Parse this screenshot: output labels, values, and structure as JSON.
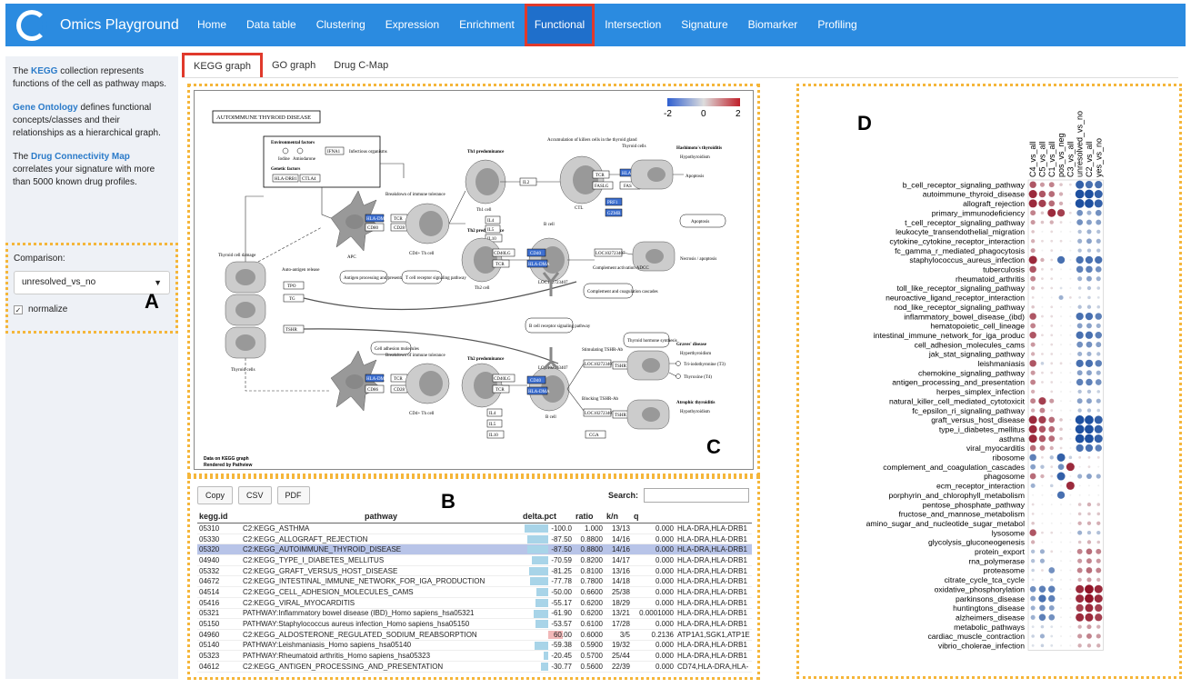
{
  "app": {
    "title": "Omics Playground"
  },
  "nav": {
    "items": [
      "Home",
      "Data table",
      "Clustering",
      "Expression",
      "Enrichment",
      "Functional",
      "Intersection",
      "Signature",
      "Biomarker",
      "Profiling"
    ],
    "active": "Functional"
  },
  "sidebar": {
    "p1_pre": "The ",
    "p1_link": "KEGG",
    "p1_post": " collection represents functions of the cell as pathway maps.",
    "p2_link": "Gene Ontology",
    "p2_post": " defines functional concepts/classes and their relationships as a hierarchical graph.",
    "p3_pre": "The ",
    "p3_link": "Drug Connectivity Map",
    "p3_post": " correlates your signature with more than 5000 known drug profiles.",
    "comparison_label": "Comparison:",
    "comparison_value": "unresolved_vs_no",
    "normalize_label": "normalize"
  },
  "panel_letters": {
    "a": "A",
    "b": "B",
    "c": "C",
    "d": "D"
  },
  "tabs": [
    "KEGG graph",
    "GO graph",
    "Drug C-Map"
  ],
  "kegg": {
    "title": "AUTOIMMUNE THYROID DISEASE",
    "legend_ticks": [
      "-2",
      "0",
      "2"
    ],
    "footer1": "Data on KEGG graph",
    "footer2": "Rendered by Pathview",
    "labels": {
      "env": "Environmental factors",
      "iodine": "Iodine",
      "amiodarone": "Amiodarone",
      "ifna1": "IFNA1",
      "infect": "Infectious organisms",
      "genetic": "Genetic factors",
      "hladrb": "HLA-DRB1",
      "ctla4": "CTLA4",
      "th1pre": "Th1 predominance",
      "accum": "Accumulation of killers cells in the thyroid gland",
      "thyroid_cells": "Thyroid cells",
      "hashimoto": "Hashimoto's thyroiditis",
      "hypo": "Hypothyroidism",
      "apoptosis": "Apoptosis",
      "breakdown": "Breakdown of immune tolerance",
      "antigen": "Antigen",
      "hladma": "HLA-DMA",
      "tcr": "TCR",
      "cd80": "CD80",
      "cd28": "CD28",
      "apc": "APC",
      "cd4": "CD4+ Th cell",
      "th1cell": "Th1 cell",
      "il2": "IL2",
      "hlae": "HLA-E",
      "faslg": "FASLG",
      "fas": "FAS",
      "prf1": "PRF1",
      "gzmb": "GZMB",
      "ctl": "CTL",
      "apoptosis2": "Apoptosis",
      "thyroid_damage": "Thyroid cell damage",
      "autoag": "Auto-antigen release",
      "tpo": "TPO",
      "tg": "TG",
      "tshr": "TSHR",
      "aproc": "Antigen processing and presentation",
      "tcrsig": "T cell receptor signaling pathway",
      "il4": "IL4",
      "il5": "IL5",
      "il10": "IL10",
      "cd40lg": "CD40LG",
      "cd40": "CD40",
      "bcell": "B cell",
      "th2cell": "Th2 cell",
      "loc": "LOC102723407",
      "necrosis": "Necrosis / apoptosis",
      "comp": "Complement activation ADCC",
      "compcasc": "Complement and coagulation cascades",
      "bcr": "B cell receptor signaling pathway",
      "celladh": "Cell adhesion molecules",
      "th2pre": "Th2 predominance",
      "thyroid_horm": "Thyroid hormone synthesis",
      "graves": "Graves' disease",
      "hyper": "Hyperthyroidism",
      "stim": "Stimulating TSHR-Ab",
      "block": "Blocking TSHR-Ab",
      "t3": "Tri-iodothyronine (T3)",
      "t4": "Thyroxine (T4)",
      "atrophic": "Atrophic thyroiditis",
      "hypo2": "Hypothyroidism",
      "cga": "CGA",
      "cd86": "CD86",
      "thyroid_cells2": "Thyroid cells"
    }
  },
  "table": {
    "buttons": [
      "Copy",
      "CSV",
      "PDF"
    ],
    "search_label": "Search:",
    "columns": [
      "kegg.id",
      "pathway",
      "delta.pct",
      "ratio",
      "k/n",
      "q",
      ""
    ],
    "rows": [
      [
        "05310",
        "C2:KEGG_ASTHMA",
        "-100.0",
        "1.000",
        "13/13",
        "0.000",
        "HLA-DRA,HLA-DRB1"
      ],
      [
        "05330",
        "C2:KEGG_ALLOGRAFT_REJECTION",
        "-87.50",
        "0.8800",
        "14/16",
        "0.000",
        "HLA-DRA,HLA-DRB1"
      ],
      [
        "05320",
        "C2:KEGG_AUTOIMMUNE_THYROID_DISEASE",
        "-87.50",
        "0.8800",
        "14/16",
        "0.000",
        "HLA-DRA,HLA-DRB1"
      ],
      [
        "04940",
        "C2:KEGG_TYPE_I_DIABETES_MELLITUS",
        "-70.59",
        "0.8200",
        "14/17",
        "0.000",
        "HLA-DRA,HLA-DRB1"
      ],
      [
        "05332",
        "C2:KEGG_GRAFT_VERSUS_HOST_DISEASE",
        "-81.25",
        "0.8100",
        "13/16",
        "0.000",
        "HLA-DRA,HLA-DRB1"
      ],
      [
        "04672",
        "C2:KEGG_INTESTINAL_IMMUNE_NETWORK_FOR_IGA_PRODUCTION",
        "-77.78",
        "0.7800",
        "14/18",
        "0.000",
        "HLA-DRA,HLA-DRB1"
      ],
      [
        "04514",
        "C2:KEGG_CELL_ADHESION_MOLECULES_CAMS",
        "-50.00",
        "0.6600",
        "25/38",
        "0.000",
        "HLA-DRA,HLA-DRB1"
      ],
      [
        "05416",
        "C2:KEGG_VIRAL_MYOCARDITIS",
        "-55.17",
        "0.6200",
        "18/29",
        "0.000",
        "HLA-DRA,HLA-DRB1"
      ],
      [
        "05321",
        "PATHWAY:Inflammatory bowel disease (IBD)_Homo sapiens_hsa05321",
        "-61.90",
        "0.6200",
        "13/21",
        "0.0001000",
        "HLA-DRA,HLA-DRB1"
      ],
      [
        "05150",
        "PATHWAY:Staphylococcus aureus infection_Homo sapiens_hsa05150",
        "-53.57",
        "0.6100",
        "17/28",
        "0.000",
        "HLA-DRA,HLA-DRB1"
      ],
      [
        "04960",
        "C2:KEGG_ALDOSTERONE_REGULATED_SODIUM_REABSORPTION",
        "60.00",
        "0.6000",
        "3/5",
        "0.2136",
        "ATP1A1,SGK1,ATP1E"
      ],
      [
        "05140",
        "PATHWAY:Leishmaniasis_Homo sapiens_hsa05140",
        "-59.38",
        "0.5900",
        "19/32",
        "0.000",
        "HLA-DRA,HLA-DRB1"
      ],
      [
        "05323",
        "PATHWAY:Rheumatoid arthritis_Homo sapiens_hsa05323",
        "-20.45",
        "0.5700",
        "25/44",
        "0.000",
        "HLA-DRA,HLA-DRB1"
      ],
      [
        "04612",
        "C2:KEGG_ANTIGEN_PROCESSING_AND_PRESENTATION",
        "-30.77",
        "0.5600",
        "22/39",
        "0.000",
        "CD74,HLA-DRA,HLA-"
      ]
    ],
    "delta_values": [
      -100.0,
      -87.5,
      -87.5,
      -70.59,
      -81.25,
      -77.78,
      -50.0,
      -55.17,
      -61.9,
      -53.57,
      60.0,
      -59.38,
      -20.45,
      -30.77
    ],
    "selected_row": 2
  },
  "heatmap": {
    "columns": [
      "C4_vs_all",
      "C5_vs_all",
      "C1_vs_all",
      "pos_vs_neg",
      "C3_vs_all",
      "unresolved_vs_no",
      "C2_vs_all",
      "yes_vs_no"
    ],
    "rows": [
      "b_cell_receptor_signaling_pathway",
      "autoimmune_thyroid_disease",
      "allograft_rejection",
      "primary_immunodeficiency",
      "t_cell_receptor_signaling_pathway",
      "leukocyte_transendothelial_migration",
      "cytokine_cytokine_receptor_interaction",
      "fc_gamma_r_mediated_phagocytosis",
      "staphylococcus_aureus_infection",
      "tuberculosis",
      "rheumatoid_arthritis",
      "toll_like_receptor_signaling_pathway",
      "neuroactive_ligand_receptor_interaction",
      "nod_like_receptor_signaling_pathway",
      "inflammatory_bowel_disease_(ibd)",
      "hematopoietic_cell_lineage",
      "intestinal_immune_network_for_iga_produc",
      "cell_adhesion_molecules_cams",
      "jak_stat_signaling_pathway",
      "leishmaniasis",
      "chemokine_signaling_pathway",
      "antigen_processing_and_presentation",
      "herpes_simplex_infection",
      "natural_killer_cell_mediated_cytotoxicit",
      "fc_epsilon_ri_signaling_pathway",
      "graft_versus_host_disease",
      "type_i_diabetes_mellitus",
      "asthma",
      "viral_myocarditis",
      "ribosome",
      "complement_and_coagulation_cascades",
      "phagosome",
      "ecm_receptor_interaction",
      "porphyrin_and_chlorophyll_metabolism",
      "pentose_phosphate_pathway",
      "fructose_and_mannose_metabolism",
      "amino_sugar_and_nucleotide_sugar_metabol",
      "lysosome",
      "glycolysis_gluconeogenesis",
      "protein_export",
      "rna_polymerase",
      "proteasome",
      "citrate_cycle_tca_cycle",
      "oxidative_phosphorylation",
      "parkinsons_disease",
      "huntingtons_disease",
      "alzheimers_disease",
      "metabolic_pathways",
      "cardiac_muscle_contraction",
      "vibrio_cholerae_infection"
    ],
    "values": [
      [
        0.7,
        0.4,
        0.5,
        0.2,
        0.1,
        -0.9,
        -0.8,
        -0.8
      ],
      [
        0.9,
        0.7,
        0.6,
        0.3,
        0,
        -1,
        -1,
        -0.9
      ],
      [
        0.9,
        0.8,
        0.6,
        0.3,
        0,
        -1,
        -1,
        -0.9
      ],
      [
        0.5,
        0.2,
        0.9,
        0.8,
        0.1,
        -0.6,
        -0.4,
        -0.6
      ],
      [
        0.4,
        0.2,
        0.3,
        0.1,
        0,
        -0.6,
        -0.5,
        -0.5
      ],
      [
        0.2,
        0,
        0.1,
        0,
        0,
        -0.3,
        -0.4,
        -0.3
      ],
      [
        0.3,
        0.1,
        0.1,
        0.1,
        0,
        -0.4,
        -0.5,
        -0.4
      ],
      [
        0.4,
        0,
        0.1,
        0,
        0,
        -0.3,
        -0.3,
        -0.3
      ],
      [
        0.9,
        0.3,
        0.1,
        -0.8,
        0,
        -0.8,
        -0.8,
        -0.8
      ],
      [
        0.7,
        0.1,
        0.1,
        0,
        0,
        -0.7,
        -0.7,
        -0.6
      ],
      [
        0.5,
        0.1,
        0.1,
        0,
        0,
        -0.4,
        -0.5,
        -0.4
      ],
      [
        0.3,
        0.1,
        0.1,
        -0.1,
        0,
        -0.2,
        -0.3,
        -0.2
      ],
      [
        0.1,
        0,
        0,
        -0.4,
        0.1,
        -0.1,
        -0.2,
        -0.1
      ],
      [
        0.2,
        0,
        0.1,
        0,
        0,
        -0.3,
        -0.3,
        -0.2
      ],
      [
        0.7,
        0.1,
        0.1,
        0,
        0,
        -0.8,
        -0.8,
        -0.7
      ],
      [
        0.5,
        0,
        0.1,
        0,
        0,
        -0.5,
        -0.5,
        -0.4
      ],
      [
        0.7,
        0.1,
        0.1,
        0,
        0,
        -0.8,
        -0.8,
        -0.7
      ],
      [
        0.4,
        0,
        0.1,
        0,
        0,
        -0.6,
        -0.6,
        -0.5
      ],
      [
        0.3,
        0.1,
        0.1,
        0,
        0,
        -0.4,
        -0.4,
        -0.3
      ],
      [
        0.7,
        -0.2,
        0.1,
        0.1,
        0,
        -0.8,
        -0.8,
        -0.7
      ],
      [
        0.4,
        0.1,
        0.1,
        0,
        0,
        -0.5,
        -0.5,
        -0.4
      ],
      [
        0.5,
        0.1,
        0.1,
        0,
        0,
        -0.7,
        -0.7,
        -0.6
      ],
      [
        0.3,
        0,
        0.1,
        0,
        0,
        -0.3,
        -0.3,
        -0.2
      ],
      [
        0.5,
        0.8,
        0.4,
        0,
        0,
        -0.5,
        -0.5,
        -0.4
      ],
      [
        0.3,
        0.5,
        0.1,
        0,
        0,
        -0.3,
        -0.3,
        -0.2
      ],
      [
        0.9,
        0.8,
        0.6,
        0.2,
        0,
        -1,
        -1,
        -0.9
      ],
      [
        0.9,
        0.7,
        0.6,
        0.2,
        0,
        -1,
        -1,
        -0.9
      ],
      [
        0.9,
        0.7,
        0.6,
        0.2,
        0,
        -1,
        -1,
        -0.9
      ],
      [
        0.6,
        0.5,
        0.3,
        0.1,
        0,
        -0.8,
        -0.8,
        -0.7
      ],
      [
        -0.7,
        0.1,
        -0.3,
        -0.9,
        -0.2,
        0.1,
        0.1,
        0.1
      ],
      [
        -0.5,
        -0.3,
        0.1,
        -0.6,
        0.9,
        0,
        0.1,
        0
      ],
      [
        0.6,
        0.3,
        0.1,
        -0.9,
        0,
        -0.4,
        -0.5,
        -0.4
      ],
      [
        -0.4,
        0,
        -0.2,
        0,
        0.9,
        0,
        0,
        0
      ],
      [
        0,
        0,
        0,
        -0.8,
        0,
        0,
        0,
        0
      ],
      [
        0.1,
        0,
        0,
        0,
        0,
        0.2,
        0.3,
        0.2
      ],
      [
        0.1,
        0,
        0,
        0,
        0,
        0.2,
        0.2,
        0.2
      ],
      [
        0.2,
        0,
        0,
        0,
        0,
        0.3,
        0.3,
        0.3
      ],
      [
        0.7,
        0.1,
        0.1,
        0,
        0,
        -0.4,
        -0.3,
        -0.3
      ],
      [
        0.3,
        0,
        0,
        0,
        0,
        0.2,
        0.3,
        0.2
      ],
      [
        -0.3,
        -0.4,
        0.1,
        0,
        0,
        0.5,
        0.6,
        0.5
      ],
      [
        -0.3,
        -0.4,
        0,
        0,
        0,
        0.4,
        0.5,
        0.4
      ],
      [
        -0.2,
        0.1,
        -0.6,
        0,
        0,
        0.5,
        0.6,
        0.5
      ],
      [
        -0.1,
        0,
        -0.2,
        0,
        0,
        0.3,
        0.4,
        0.3
      ],
      [
        -0.6,
        -0.7,
        -0.7,
        0,
        0,
        0.9,
        1,
        0.9
      ],
      [
        -0.5,
        -0.8,
        -0.7,
        0,
        0,
        0.9,
        1,
        0.9
      ],
      [
        -0.4,
        -0.6,
        -0.5,
        0,
        0,
        0.8,
        0.9,
        0.8
      ],
      [
        -0.4,
        -0.7,
        -0.6,
        0,
        0,
        0.9,
        0.9,
        0.8
      ],
      [
        -0.1,
        -0.2,
        -0.1,
        0,
        0,
        0.3,
        0.4,
        0.3
      ],
      [
        -0.2,
        -0.4,
        -0.1,
        0,
        0,
        0.4,
        0.5,
        0.4
      ],
      [
        -0.1,
        -0.2,
        -0.1,
        0,
        0,
        0.3,
        0.3,
        0.3
      ]
    ]
  },
  "colors": {
    "accent": "#2b8be0",
    "selection": "#e0392b",
    "highlight_box": "#f5b63a"
  }
}
